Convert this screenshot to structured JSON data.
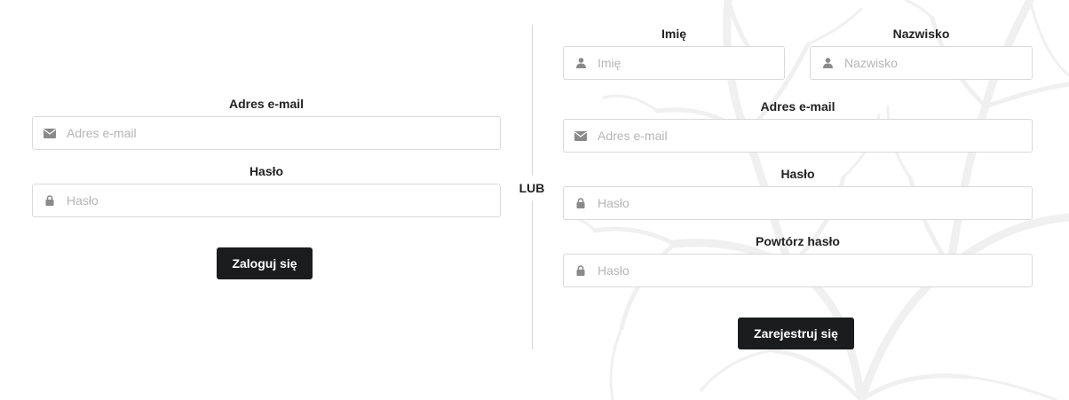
{
  "login": {
    "email_label": "Adres e-mail",
    "email_placeholder": "Adres e-mail",
    "password_label": "Hasło",
    "password_placeholder": "Hasło",
    "submit_label": "Zaloguj się"
  },
  "divider": {
    "label": "LUB"
  },
  "register": {
    "first_name_label": "Imię",
    "first_name_placeholder": "Imię",
    "last_name_label": "Nazwisko",
    "last_name_placeholder": "Nazwisko",
    "email_label": "Adres e-mail",
    "email_placeholder": "Adres e-mail",
    "password_label": "Hasło",
    "password_placeholder": "Hasło",
    "repeat_password_label": "Powtórz hasło",
    "repeat_password_placeholder": "Hasło",
    "submit_label": "Zarejestruj się"
  },
  "icons": {
    "email": "envelope-icon",
    "password": "lock-icon",
    "name": "user-icon"
  },
  "colors": {
    "button_bg": "#1b1c1d",
    "button_text": "#ffffff",
    "border": "#d9d9d9",
    "placeholder": "#b5b5b5",
    "icon": "#8a8a8a",
    "divider": "#d4d4d5"
  }
}
